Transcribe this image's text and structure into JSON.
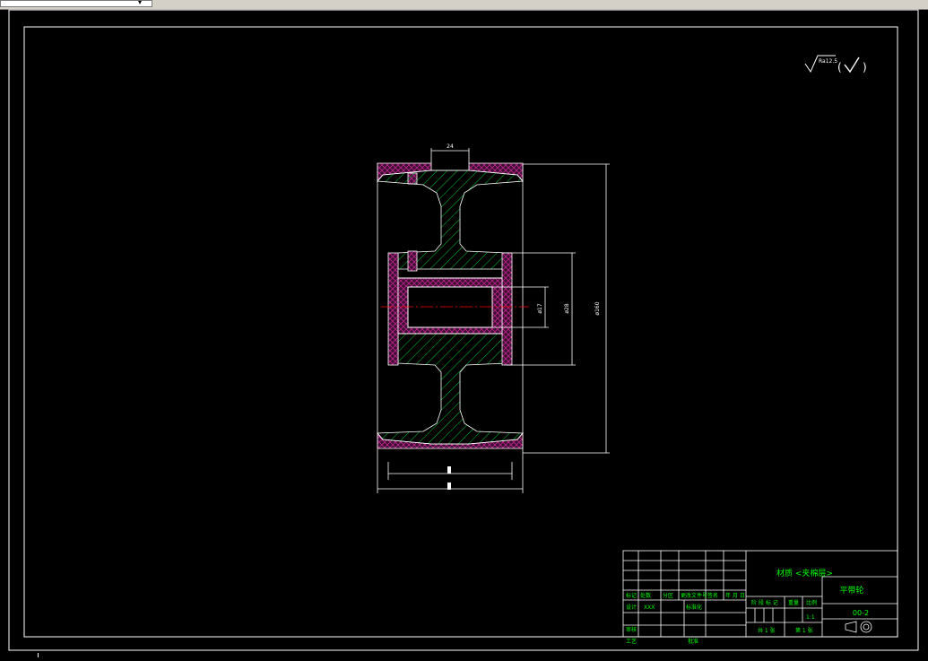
{
  "window": {
    "toolbar_field_value": ""
  },
  "surface_finish": {
    "symbol": "√",
    "value": "Ra12.5",
    "paren_symbol": "√"
  },
  "dimensions": {
    "hub_width": "24",
    "bore_dia": "ø17",
    "hub_dia": "ø28",
    "outer_dia": "ø160"
  },
  "title_block": {
    "material": "材质 <夹棉层>",
    "part_name": "平带轮",
    "drawing_no": "00-2",
    "weight_label": "重量",
    "scale_label": "比例",
    "stage_labels": "阶 段 标 记",
    "scale_value": "1:1",
    "total_sheets": "共 1 张",
    "sheet_no": "第 1 张",
    "row_labels": [
      "标记",
      "处数",
      "分区",
      "更改文件号",
      "签名",
      "年 月 日"
    ],
    "design": "设计",
    "design_code": "XXX",
    "standardize": "标准化",
    "review": "审核",
    "process": "工艺",
    "approve": "批准"
  },
  "colors": {
    "frame": "#ffffff",
    "outline": "#ffffff",
    "hatch": "#00ff40",
    "rubber": "#c0208c",
    "centerline": "#ff0000",
    "title_text": "#00ff00"
  }
}
